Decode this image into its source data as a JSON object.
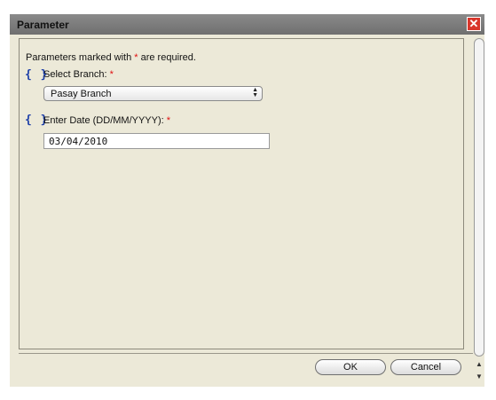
{
  "window": {
    "title": "Parameter",
    "close_glyph": "✕"
  },
  "form": {
    "required_note_prefix": "Parameters marked with ",
    "required_star": "*",
    "required_note_suffix": " are required.",
    "param_icon_glyph": "{ }",
    "branch": {
      "label": "Select Branch:",
      "star": "*",
      "value": "Pasay Branch"
    },
    "date": {
      "label": "Enter Date (DD/MM/YYYY):",
      "star": "*",
      "value": "03/04/2010"
    }
  },
  "buttons": {
    "ok": "OK",
    "cancel": "Cancel"
  },
  "scroll": {
    "up": "▲",
    "down": "▼"
  },
  "colors": {
    "required_star": "#e01010",
    "param_icon": "#1d3fa8",
    "close_button": "#d9362b"
  }
}
